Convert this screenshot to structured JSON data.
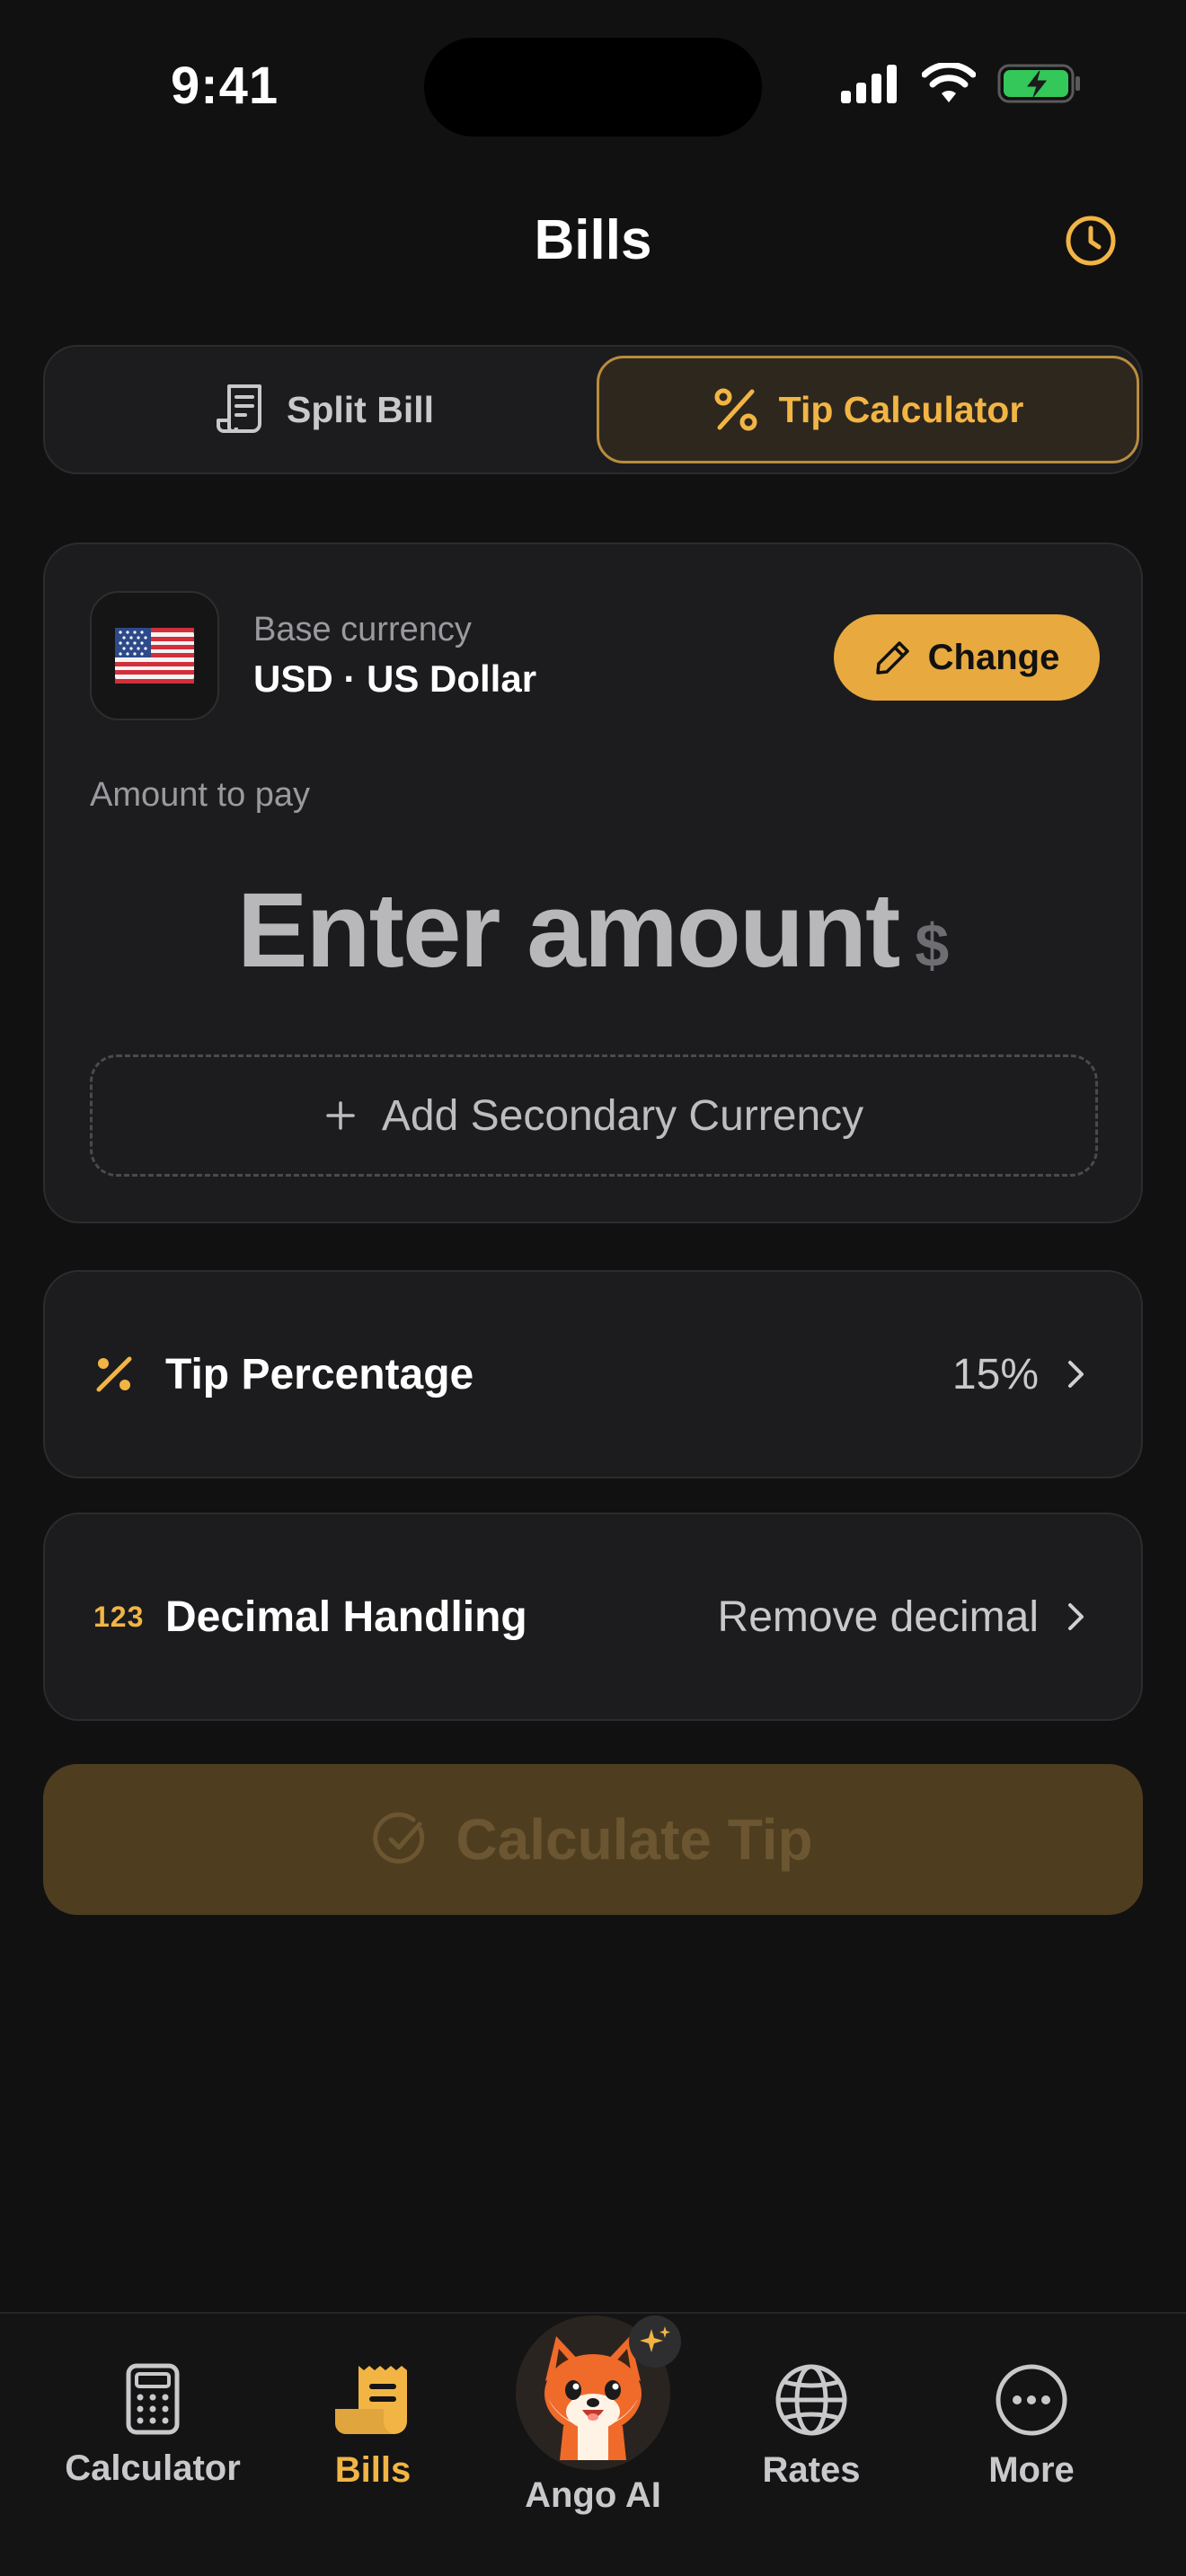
{
  "status_bar": {
    "time": "9:41"
  },
  "header": {
    "title": "Bills",
    "history_icon": "clock-icon"
  },
  "segmented": {
    "split_label": "Split Bill",
    "tip_label": "Tip Calculator",
    "active": "tip"
  },
  "currency_card": {
    "flag": "🇺🇸",
    "base_label": "Base currency",
    "base_value": "USD · US Dollar",
    "change_label": "Change",
    "amount_label": "Amount to pay",
    "amount_placeholder": "Enter amount",
    "currency_symbol": "$",
    "add_secondary_label": "Add Secondary Currency"
  },
  "tip_row": {
    "label": "Tip Percentage",
    "value": "15%"
  },
  "decimal_row": {
    "label": "Decimal Handling",
    "value": "Remove decimal",
    "icon_text": "123"
  },
  "calculate_button": {
    "label": "Calculate Tip",
    "enabled": false
  },
  "tabbar": {
    "tabs": [
      {
        "label": "Calculator",
        "icon": "calculator-icon"
      },
      {
        "label": "Bills",
        "icon": "receipt-icon",
        "active": true
      },
      {
        "label": "Ango AI",
        "icon": "fox-avatar-icon"
      },
      {
        "label": "Rates",
        "icon": "globe-icon"
      },
      {
        "label": "More",
        "icon": "more-icon"
      }
    ]
  },
  "colors": {
    "accent": "#f2b544",
    "button_accent": "#e8a93e",
    "background": "#111112",
    "card": "#1c1c1e",
    "disabled_button": "#4f3d20"
  }
}
